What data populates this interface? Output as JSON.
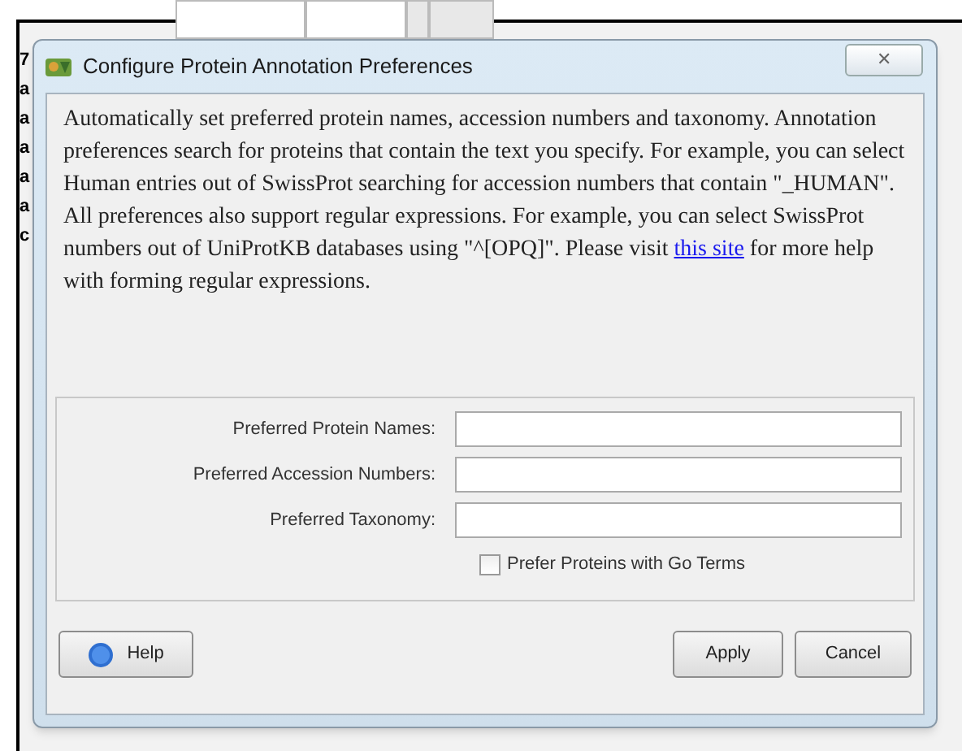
{
  "background": {
    "row_labels": [
      "7",
      "a",
      "a",
      "a",
      "a",
      "a",
      "c"
    ]
  },
  "dialog": {
    "title": "Configure Protein Annotation Preferences",
    "close": "✕",
    "description_before": "Automatically set preferred protein names, accession numbers and taxonomy. Annotation preferences search for proteins that contain the text you specify. For example, you can select Human entries out of SwissProt searching for accession numbers that contain \"_HUMAN\". All preferences also support regular expressions. For example, you can select SwissProt numbers out of UniProtKB databases using \"^[OPQ]\". Please visit",
    "link": "this site",
    "description_after": "for more help with forming regular expressions.",
    "fields": [
      {
        "label": "Preferred Protein Names:"
      },
      {
        "label": "Preferred Accession Numbers:"
      },
      {
        "label": "Preferred Taxonomy:"
      }
    ],
    "checkbox": {
      "label": "Prefer Proteins with Go Terms",
      "checked": false
    },
    "buttons": [
      {
        "label": "Help",
        "kind": "help"
      },
      {
        "label": "Apply",
        "kind": "plain"
      },
      {
        "label": "Cancel",
        "kind": "plain"
      }
    ]
  }
}
